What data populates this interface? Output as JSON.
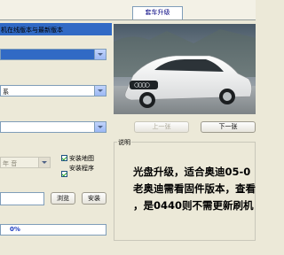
{
  "tab": {
    "label": "套车升级"
  },
  "top_bar": {
    "text": "机在线版本与最新版本"
  },
  "fields": {
    "field1_value": "",
    "field2_value": "系",
    "field3_value": ""
  },
  "nav": {
    "prev_label": "上一张",
    "next_label": "下一张"
  },
  "options": {
    "dropdown_value": "年 音",
    "install_map_label": "安装地图",
    "install_software_label": "安装程序"
  },
  "actions": {
    "browse_label": "浏览",
    "install_label": "安装"
  },
  "description": {
    "group_label": "说明",
    "lines": [
      "光盘升级，适合奥迪05-0",
      "老奥迪需看固件版本，查看",
      "，是0440则不需更新刷机"
    ]
  },
  "progress": {
    "text": "0%",
    "value": 0
  },
  "colors": {
    "selection": "#316ac5",
    "progress_text": "#1c3cc0"
  }
}
